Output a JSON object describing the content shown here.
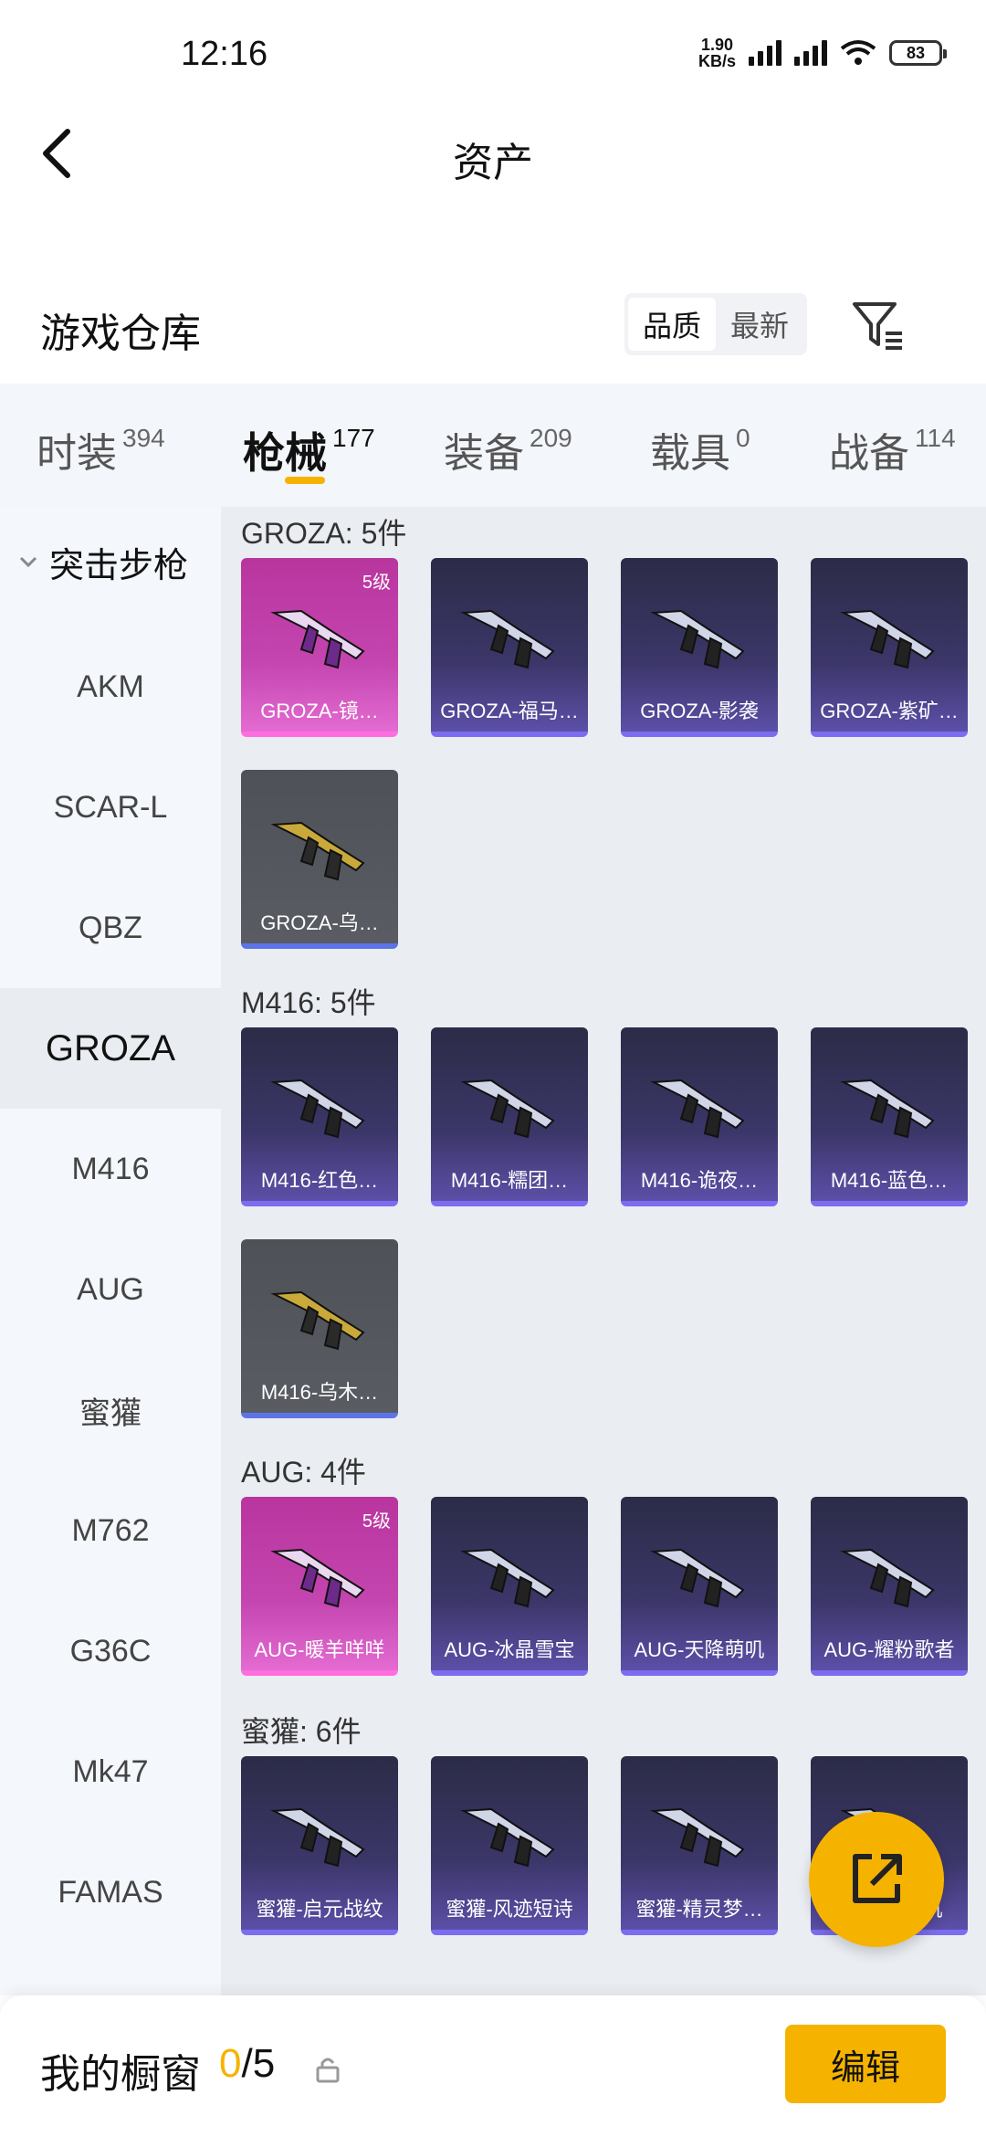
{
  "status_bar": {
    "time": "12:16",
    "net_speed_value": "1.90",
    "net_speed_unit": "KB/s",
    "wifi_sub": "6",
    "battery": "83"
  },
  "header": {
    "title": "资产"
  },
  "warehouse": {
    "title": "游戏仓库",
    "sort_options": [
      "品质",
      "最新"
    ],
    "sort_active": "品质"
  },
  "tabs": [
    {
      "label": "时装",
      "count": "394"
    },
    {
      "label": "枪械",
      "count": "177"
    },
    {
      "label": "装备",
      "count": "209"
    },
    {
      "label": "载具",
      "count": "0"
    },
    {
      "label": "战备",
      "count": "114"
    }
  ],
  "sidebar": {
    "group": "突击步枪",
    "items": [
      "AKM",
      "SCAR-L",
      "QBZ",
      "GROZA",
      "M416",
      "AUG",
      "蜜獾",
      "M762",
      "G36C",
      "Mk47",
      "FAMAS"
    ],
    "active": "GROZA"
  },
  "sections": [
    {
      "title": "GROZA: 5件",
      "cards": [
        {
          "label": "GROZA-镜…",
          "rarity": "pink",
          "level": "5级"
        },
        {
          "label": "GROZA-福马…",
          "rarity": "purple"
        },
        {
          "label": "GROZA-影袭",
          "rarity": "purple"
        },
        {
          "label": "GROZA-紫矿…",
          "rarity": "purple"
        },
        {
          "label": "GROZA-乌…",
          "rarity": "gray"
        }
      ]
    },
    {
      "title": "M416: 5件",
      "cards": [
        {
          "label": "M416-红色…",
          "rarity": "purple"
        },
        {
          "label": "M416-糯团…",
          "rarity": "purple"
        },
        {
          "label": "M416-诡夜…",
          "rarity": "purple"
        },
        {
          "label": "M416-蓝色…",
          "rarity": "purple"
        },
        {
          "label": "M416-乌木…",
          "rarity": "gray"
        }
      ]
    },
    {
      "title": "AUG: 4件",
      "cards": [
        {
          "label": "AUG-暖羊咩咩",
          "rarity": "pink",
          "level": "5级"
        },
        {
          "label": "AUG-冰晶雪宝",
          "rarity": "purple"
        },
        {
          "label": "AUG-天降萌叽",
          "rarity": "purple"
        },
        {
          "label": "AUG-耀粉歌者",
          "rarity": "purple"
        }
      ]
    },
    {
      "title": "蜜獾: 6件",
      "cards": [
        {
          "label": "蜜獾-启元战纹",
          "rarity": "purple"
        },
        {
          "label": "蜜獾-风迹短诗",
          "rarity": "purple"
        },
        {
          "label": "蜜獾-精灵梦…",
          "rarity": "purple"
        },
        {
          "label": "蜜獾-…萌叽",
          "rarity": "purple"
        }
      ]
    }
  ],
  "bottom": {
    "showcase_label": "我的橱窗",
    "showcase_current": "0",
    "showcase_total": "/5",
    "edit_label": "编辑"
  },
  "colors": {
    "accent": "#f5b300",
    "purple_rarity": "#7b6cf0",
    "pink_rarity": "#ff6ee0"
  }
}
